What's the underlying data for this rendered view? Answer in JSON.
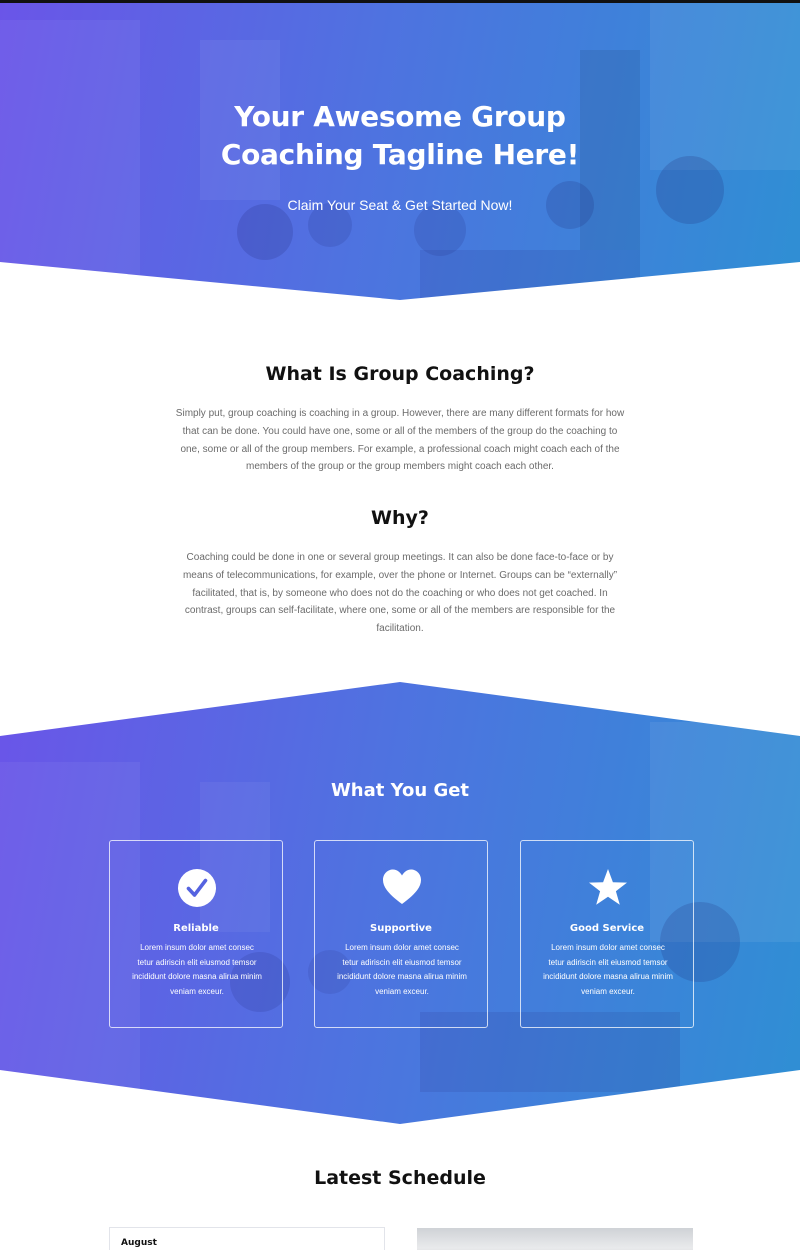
{
  "hero": {
    "title_line1": "Your Awesome Group",
    "title_line2": "Coaching Tagline Here!",
    "subtitle": "Claim Your Seat & Get Started Now!"
  },
  "intro": {
    "heading": "What Is Group Coaching?",
    "paragraph": "Simply put, group coaching is coaching in a group. However, there are many different formats for how that can be done. You could have one, some or all of the members of the group do the coaching to one, some or all of the group members. For example, a professional coach might coach each of the members of the group or the group members might coach each other."
  },
  "why": {
    "heading": "Why?",
    "paragraph": "Coaching could be done in one or several group meetings. It can also be done face-to-face or by means of telecommunications, for example, over the phone or Internet. Groups can be “externally” facilitated, that is, by someone who does not do the coaching or who does not get coached. In contrast, groups can self-facilitate, where one, some or all of the members are responsible for the facilitation."
  },
  "features": {
    "heading": "What You Get",
    "cards": [
      {
        "icon": "check-circle-icon",
        "title": "Reliable",
        "text": "Lorem insum dolor amet consec tetur adiriscin elit eiusmod temsor incididunt dolore masna alirua minim veniam exceur."
      },
      {
        "icon": "heart-icon",
        "title": "Supportive",
        "text": "Lorem insum dolor amet consec tetur adiriscin elit eiusmod temsor incididunt dolore masna alirua minim veniam exceur."
      },
      {
        "icon": "star-icon",
        "title": "Good Service",
        "text": "Lorem insum dolor amet consec tetur adiriscin elit eiusmod temsor incididunt dolore masna alirua minim veniam exceur."
      }
    ]
  },
  "schedule": {
    "heading": "Latest Schedule",
    "month": "August"
  },
  "colors": {
    "gradient_start": "#6a55e8",
    "gradient_end": "#2f8fd4",
    "heading_text": "#111111",
    "body_text": "#6b6b6b",
    "light_section_bg": "#f5f7fc"
  }
}
